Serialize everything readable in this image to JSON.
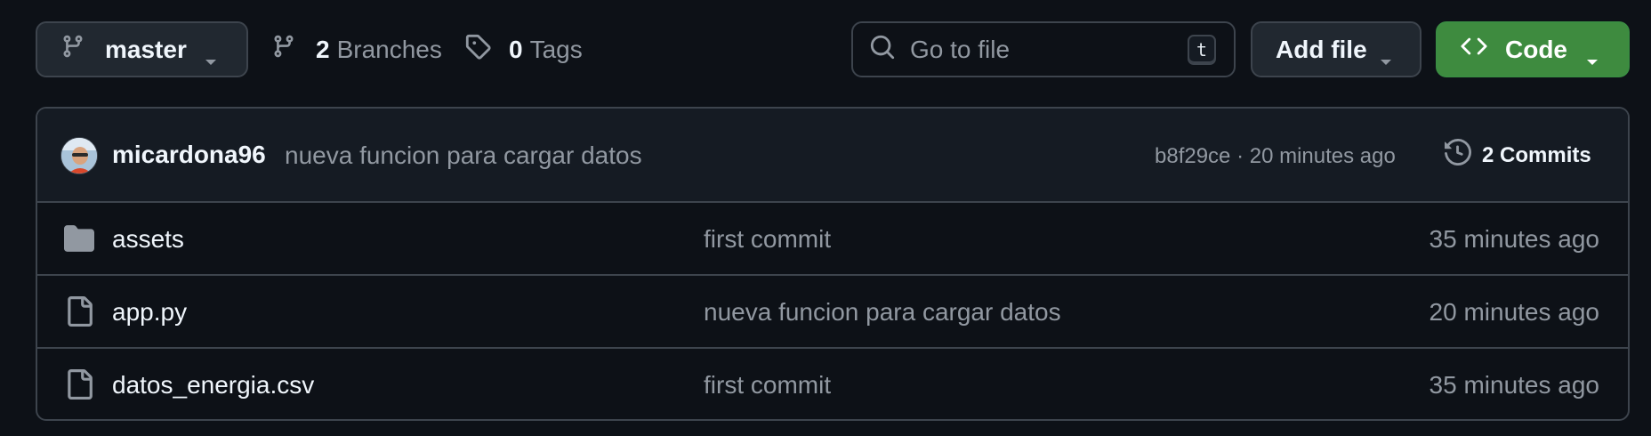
{
  "toolbar": {
    "branch_name": "master",
    "branches_count": "2",
    "branches_label": "Branches",
    "tags_count": "0",
    "tags_label": "Tags",
    "search_placeholder": "Go to file",
    "search_shortcut": "t",
    "add_file_label": "Add file",
    "code_label": "Code"
  },
  "latest_commit": {
    "author": "micardona96",
    "message": "nueva funcion para cargar datos",
    "meta": "b8f29ce · 20 minutes ago",
    "commits_label": "2 Commits"
  },
  "files": [
    {
      "type": "folder",
      "icon": "folder-icon",
      "name": "assets",
      "message": "first commit",
      "time": "35 minutes ago"
    },
    {
      "type": "file",
      "icon": "file-icon",
      "name": "app.py",
      "message": "nueva funcion para cargar datos",
      "time": "20 minutes ago"
    },
    {
      "type": "file",
      "icon": "file-icon",
      "name": "datos_energia.csv",
      "message": "first commit",
      "time": "35 minutes ago"
    }
  ],
  "colors": {
    "background": "#0d1117",
    "border": "#3d444d",
    "code_button": "#3e8b3f",
    "muted_text": "#9198a1"
  }
}
